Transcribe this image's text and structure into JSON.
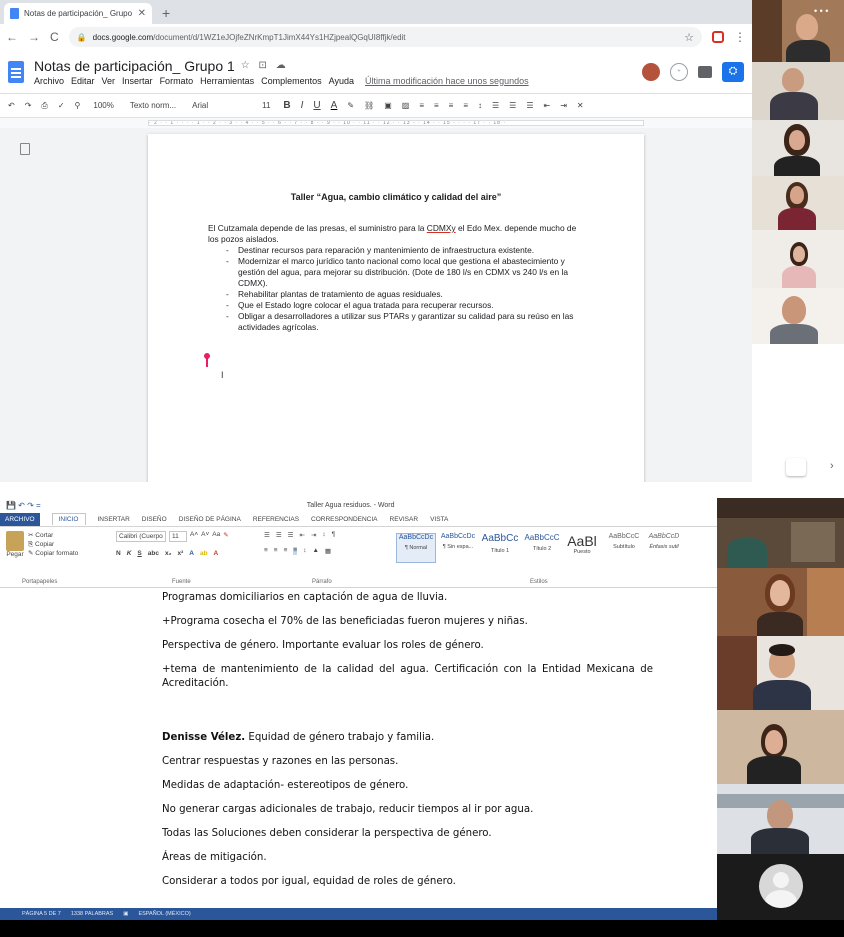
{
  "browser": {
    "tab_title": "Notas de participación_ Grupo 1",
    "new_tab": "+",
    "url_host": "docs.google.com",
    "url_path": "/document/d/1WZ1eJOjfeZNrKmpT1JimX44Ys1HZjpealQGqUI8ffjk/edit",
    "back": "←",
    "forward": "→",
    "reload": "C",
    "lock": "🔒",
    "star": "☆",
    "menu": "⋮"
  },
  "docs": {
    "title": "Notas de participación_ Grupo 1",
    "title_icons": "☆ ⊡ ☁",
    "menu": [
      "Archivo",
      "Editar",
      "Ver",
      "Insertar",
      "Formato",
      "Herramientas",
      "Complementos",
      "Ayuda"
    ],
    "last_edit": "Última modificación hace unos segundos",
    "toolbar": {
      "zoom": "100%",
      "style": "Texto norm...",
      "font": "Arial",
      "size": "11",
      "bold": "B",
      "italic": "I",
      "underline": "U",
      "color": "A"
    },
    "heading": "Taller “Agua, cambio climático y calidad del aire”",
    "para_lead": "El Cutzamala depende de las presas, el suministro para la ",
    "para_cdmx": "CDMXy",
    "para_tail": " el Edo Mex. depende mucho de los pozos aislados.",
    "bullets": [
      "Destinar recursos para reparación y mantenimiento de infraestructura existente.",
      "Modernizar el marco jurídico tanto nacional como local que gestiona el abastecimiento y gestión del agua, para mejorar su distribución. (Dote de 180 l/s en CDMX vs 240 l/s en la CDMX).",
      "Rehabilitar plantas de tratamiento de aguas residuales.",
      "Que el Estado logre colocar el agua tratada para recuperar recursos.",
      "Obligar a desarrolladores a utilizar sus PTARs y garantizar su calidad para su reúso en las actividades agrícolas."
    ],
    "ruler": "· 2 · · 1 · · · · 1 · · 2 · · 3 · · 4 · · 5 · · 6 · · 7 · · 8 · · 9 · · 10 · · 11 · · 12 · · 13 · · 14 · · 15 · · · · 17 · · 18 ·"
  },
  "word": {
    "window_title": "Taller Agua residuos. - Word",
    "quick_access": "💾 ↶ ↷ =",
    "tabs": [
      "ARCHIVO",
      "INICIO",
      "INSERTAR",
      "DISEÑO",
      "DISEÑO DE PÁGINA",
      "REFERENCIAS",
      "CORRESPONDENCIA",
      "REVISAR",
      "VISTA"
    ],
    "clipboard": {
      "paste": "Pegar",
      "cut": "Cortar",
      "copy": "Copiar",
      "format_painter": "Copiar formato",
      "label": "Portapapeles"
    },
    "font": {
      "name": "Calibri (Cuerpo",
      "size": "11",
      "label": "Fuente"
    },
    "paragraph_label": "Párrafo",
    "styles_label": "Estilos",
    "styles": [
      {
        "preview": "AaBbCcDc",
        "name": "¶ Normal"
      },
      {
        "preview": "AaBbCcDc",
        "name": "¶ Sin espa..."
      },
      {
        "preview": "AaBbCc",
        "name": "Título 1"
      },
      {
        "preview": "AaBbCcC",
        "name": "Título 2"
      },
      {
        "preview": "AaBl",
        "name": "Puesto"
      },
      {
        "preview": "AaBbCcC",
        "name": "Subtítulo"
      },
      {
        "preview": "AaBbCcD",
        "name": "Énfasis sutil"
      }
    ],
    "lines": [
      "Programas domiciliarios en captación de agua de lluvia.",
      "+Programa cosecha el 70% de las beneficiadas fueron mujeres y niñas.",
      "Perspectiva de género. Importante evaluar los roles de género.",
      "+tema de mantenimiento de la calidad del agua. Certificación con la Entidad Mexicana de Acreditación."
    ],
    "speaker": "Denisse Vélez.",
    "speaker_rest": " Equidad de género trabajo y familia.",
    "lines2": [
      "Centrar respuestas y razones en las personas.",
      "Medidas de adaptación- estereotipos de género.",
      "No generar cargas adicionales de trabajo, reducir tiempos al ir por agua.",
      "Todas las Soluciones deben considerar la perspectiva de género.",
      "Áreas de mitigación.",
      "Considerar a todos por igual, equidad de roles de género."
    ],
    "status": {
      "page": "PÁGINA 5 DE 7",
      "words": "1338 PALABRAS",
      "lang": "ESPAÑOL (MÉXICO)"
    }
  },
  "colors": {
    "docs_blue": "#4285f4",
    "word_blue": "#2b579a",
    "share_blue": "#1a73e8"
  }
}
